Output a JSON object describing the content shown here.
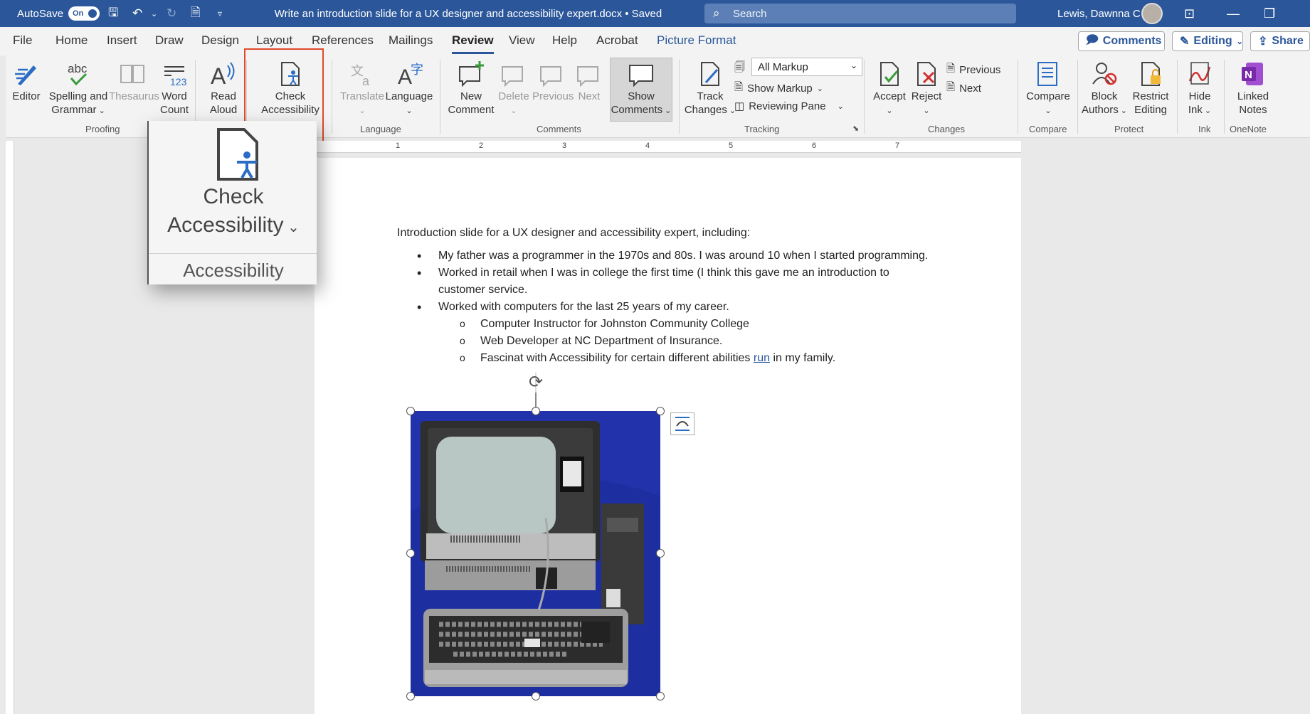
{
  "titlebar": {
    "autosave_label": "AutoSave",
    "autosave_state": "On",
    "document_title": "Write an introduction slide for a UX designer and accessibility expert.docx • Saved",
    "search_placeholder": "Search",
    "user_name": "Lewis, Dawnna C"
  },
  "menu": {
    "tabs": [
      "File",
      "Home",
      "Insert",
      "Draw",
      "Design",
      "Layout",
      "References",
      "Mailings",
      "Review",
      "View",
      "Help",
      "Acrobat",
      "Picture Format"
    ],
    "active_tab": "Review",
    "comments_button": "Comments",
    "editing_button": "Editing",
    "share_button": "Share"
  },
  "ribbon": {
    "proofing": {
      "editor": "Editor",
      "spelling_line1": "Spelling and",
      "spelling_line2": "Grammar",
      "thesaurus": "Thesaurus",
      "word_count_line1": "Word",
      "word_count_line2": "Count",
      "label": "Proofing"
    },
    "speech": {
      "read_aloud_line1": "Read",
      "read_aloud_line2": "Aloud"
    },
    "accessibility": {
      "check_line1": "Check",
      "check_line2": "Accessibility"
    },
    "language": {
      "translate": "Translate",
      "language": "Language",
      "label": "Language"
    },
    "comments": {
      "new_line1": "New",
      "new_line2": "Comment",
      "delete": "Delete",
      "previous": "Previous",
      "next": "Next",
      "show_line1": "Show",
      "show_line2": "Comments",
      "label": "Comments"
    },
    "tracking": {
      "track_line1": "Track",
      "track_line2": "Changes",
      "markup_select": "All Markup",
      "show_markup": "Show Markup",
      "reviewing_pane": "Reviewing Pane",
      "label": "Tracking"
    },
    "changes": {
      "accept": "Accept",
      "reject": "Reject",
      "previous": "Previous",
      "next": "Next",
      "label": "Changes"
    },
    "compare": {
      "compare": "Compare",
      "label": "Compare"
    },
    "protect": {
      "block_line1": "Block",
      "block_line2": "Authors",
      "restrict_line1": "Restrict",
      "restrict_line2": "Editing",
      "label": "Protect"
    },
    "ink": {
      "hide_line1": "Hide",
      "hide_line2": "Ink",
      "label": "Ink"
    },
    "onenote": {
      "linked_line1": "Linked",
      "linked_line2": "Notes",
      "label": "OneNote"
    }
  },
  "zoom_callout": {
    "line1": "Check",
    "line2": "Accessibility",
    "group": "Accessibility"
  },
  "ruler": {
    "numbers": [
      "1",
      "2",
      "3",
      "4",
      "5",
      "6",
      "7"
    ]
  },
  "document": {
    "intro": "Introduction slide for a UX designer and accessibility expert, including:",
    "bullets": [
      "My father was a programmer in the 1970s and 80s. I was around 10 when I started programming.",
      "Worked in retail when I was in college the first time (I think this gave me an introduction to customer service.",
      "Worked with computers for the last 25 years of my career."
    ],
    "sub_bullets": [
      "Computer Instructor for Johnston Community College",
      "Web Developer at NC Department of Insurance."
    ],
    "sub3_before": "Fascinat",
    "sub3_middle": " with Accessibility for certain different abilities ",
    "sub3_link": "run",
    "sub3_after": " in my family."
  },
  "colors": {
    "title_blue": "#2b579a",
    "highlight_red": "#e04a2a"
  }
}
